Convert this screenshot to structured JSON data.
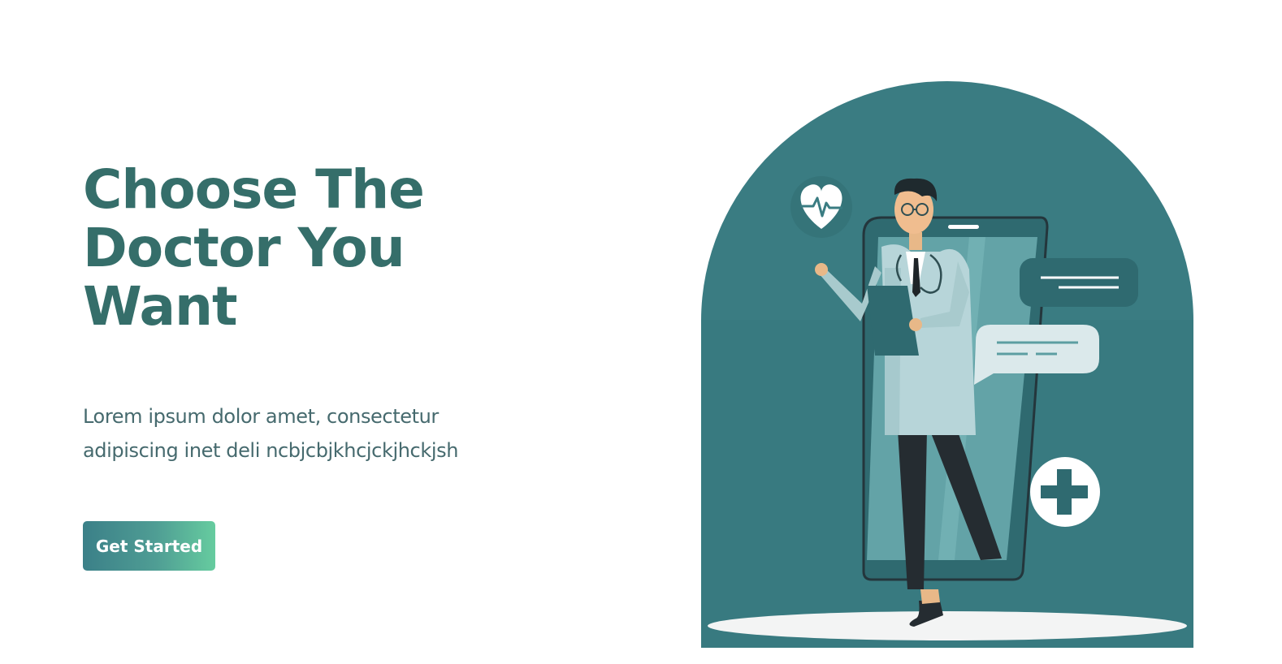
{
  "hero": {
    "title_lines": [
      "Choose The",
      "Doctor You",
      "Want"
    ],
    "description_lines": [
      "Lorem ipsum dolor amet, consectetur",
      "adipiscing inet deli ncbjcbjkhcjckjhckjsh"
    ],
    "cta_label": "Get Started"
  },
  "theme": {
    "primary": "#3a7c82",
    "heading": "#356e6a",
    "body_text": "#466a6e",
    "button_gradient": [
      "#3b8088",
      "#66cc9f"
    ]
  },
  "illustration": {
    "icons": [
      "heart-pulse-icon",
      "medical-cross-icon",
      "chat-bubble-icon",
      "message-bubble-icon",
      "phone-icon",
      "doctor-figure"
    ]
  }
}
